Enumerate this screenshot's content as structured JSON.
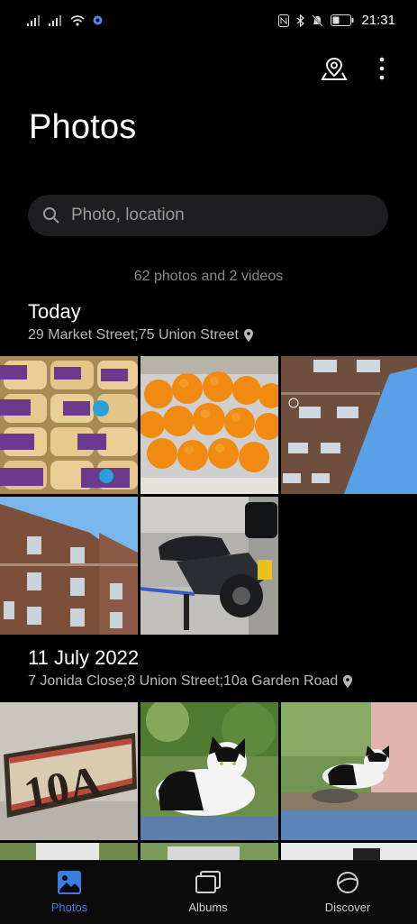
{
  "status": {
    "time": "21:31"
  },
  "header": {
    "title": "Photos"
  },
  "search": {
    "placeholder": "Photo, location"
  },
  "summary": {
    "count_text": "62 photos and 2 videos"
  },
  "sections": [
    {
      "date": "Today",
      "location": "29 Market Street;75 Union Street",
      "photos": [
        "bread-packs",
        "oranges",
        "brick-building-sky",
        "brick-building",
        "scooter"
      ]
    },
    {
      "date": "11 July 2022",
      "location": "7 Jonida Close;8 Union Street;10a Garden Road",
      "photos": [
        "house-number-10a",
        "cat-on-wall",
        "cat-on-wall-2"
      ]
    }
  ],
  "nav": [
    {
      "label": "Photos",
      "icon": "photos-icon",
      "active": true
    },
    {
      "label": "Albums",
      "icon": "albums-icon",
      "active": false
    },
    {
      "label": "Discover",
      "icon": "discover-icon",
      "active": false
    }
  ],
  "colors": {
    "accent": "#3a7de0",
    "background": "#000000",
    "search_bg": "#1e1e20"
  },
  "plate_text": "10A"
}
